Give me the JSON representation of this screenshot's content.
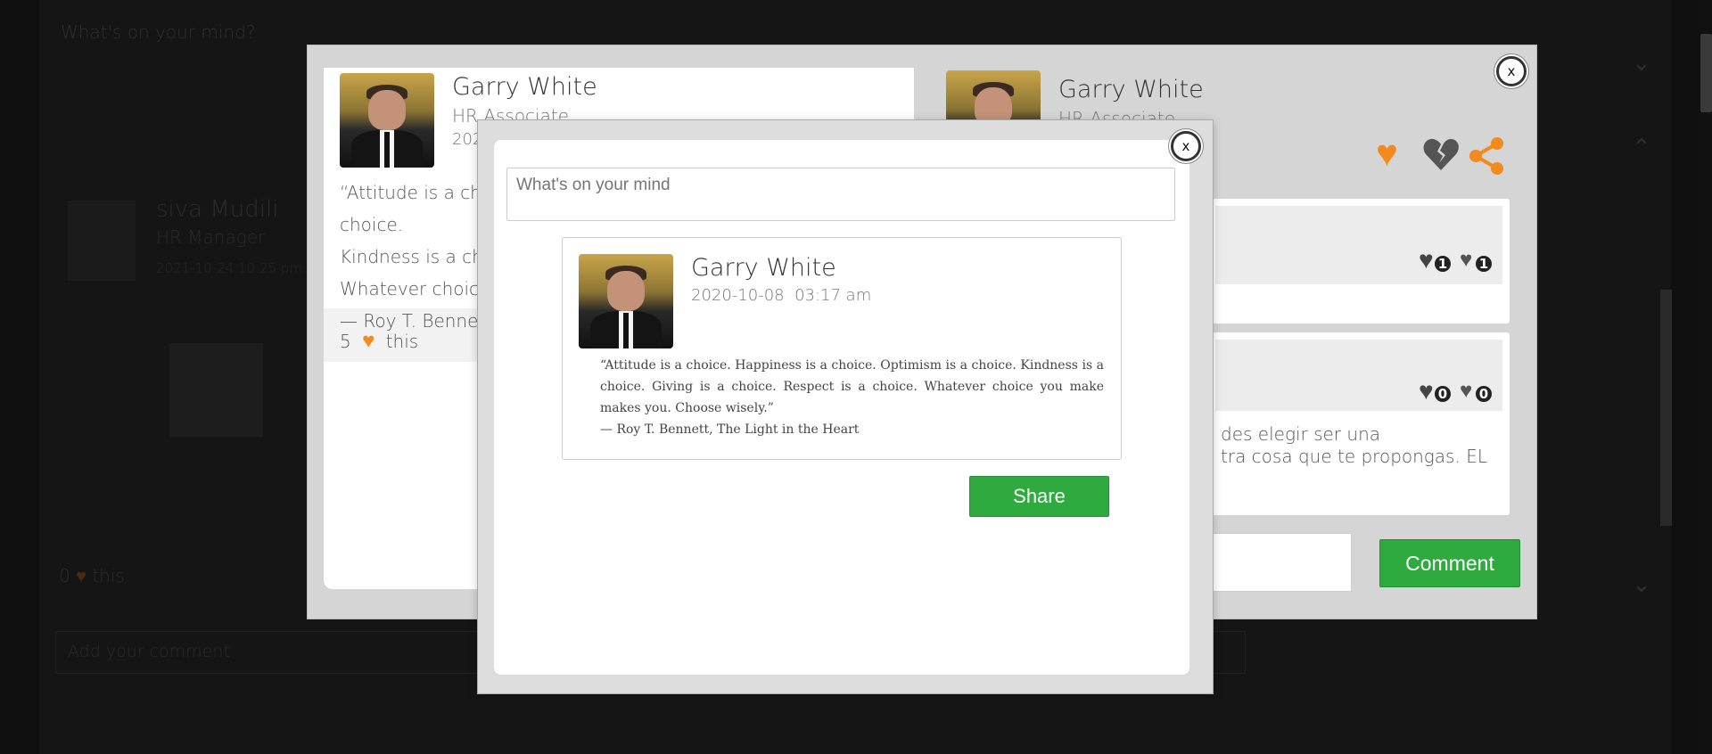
{
  "background": {
    "compose_placeholder": "What's on your mind?",
    "poster_name": "siva Mudili",
    "poster_title": "HR Manager",
    "poster_time": "2021-10-24 10:25 pm",
    "likes": "0",
    "likes_suffix": "this",
    "comment_placeholder": "Add your comment"
  },
  "post_modal": {
    "close_label": "x",
    "author": "Garry White",
    "author_title": "HR Associate",
    "date": "2020-10-08",
    "quote_lines": [
      "“Attitude is a choice. Happiness is a choice. Optimism is a choice.",
      "Kindness is a choice. Giving is a choice. Respect is a choice.",
      "Whatever choice you make makes you. Choose wisely.”",
      "— Roy T. Bennett, The Light in the Heart"
    ],
    "like_count": "5",
    "like_suffix": "this",
    "right_author": "Garry White",
    "right_title": "HR Associate",
    "comments": [
      {
        "likes": "1",
        "dislikes": "1",
        "text": ""
      },
      {
        "likes": "0",
        "dislikes": "0",
        "text": "des elegir ser una\ntra cosa que te propongas. EL"
      }
    ],
    "comment_button": "Comment",
    "icons": {
      "like": "heart-icon",
      "dislike": "broken-heart-icon",
      "share": "share-icon"
    }
  },
  "share_modal": {
    "close_label": "x",
    "textarea_placeholder": "What's on your mind",
    "author": "Garry White",
    "date": "2020-10-08",
    "time": "03:17 am",
    "quote": "“Attitude is a choice. Happiness is a choice. Optimism is a choice. Kindness is a choice. Giving is a choice. Respect is a choice. Whatever choice you make makes you. Choose wisely.”",
    "attribution": "— Roy T. Bennett, The Light in the Heart",
    "share_button": "Share"
  },
  "colors": {
    "accent_orange": "#f28a1d",
    "share_green": "#2eaa3f",
    "overlay": "#101010"
  }
}
